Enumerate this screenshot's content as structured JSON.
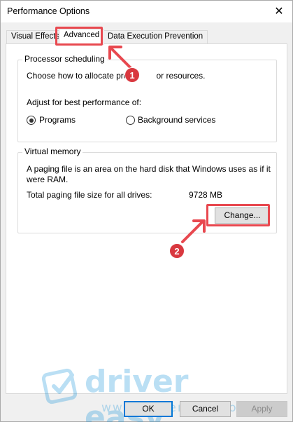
{
  "window": {
    "title": "Performance Options",
    "close_glyph": "✕"
  },
  "tabs": [
    {
      "label": "Visual Effects",
      "active": false
    },
    {
      "label": "Advanced",
      "active": true
    },
    {
      "label": "Data Execution Prevention",
      "active": false
    }
  ],
  "processor": {
    "group_label": "Processor scheduling",
    "description_before": "Choose how to allocate pro",
    "description_after": "or resources.",
    "adjust_label": "Adjust for best performance of:",
    "options": [
      {
        "label": "Programs",
        "checked": true
      },
      {
        "label": "Background services",
        "checked": false
      }
    ]
  },
  "virtual_memory": {
    "group_label": "Virtual memory",
    "description_line1": "A paging file is an area on the hard disk that Windows uses as if it",
    "description_line2": "were RAM.",
    "total_label": "Total paging file size for all drives:",
    "total_value": "9728 MB",
    "change_button": "Change..."
  },
  "annotations": {
    "badge1": "1",
    "badge2": "2",
    "color": "#e8484f"
  },
  "watermark": {
    "brand": "driver easy",
    "url": "www.DriverEasy.com"
  },
  "footer": {
    "ok_label": "OK",
    "cancel_label": "Cancel",
    "apply_label": "Apply"
  },
  "icons": {
    "close": "close-icon",
    "watermark_logo": "driver-easy-logo-icon"
  }
}
